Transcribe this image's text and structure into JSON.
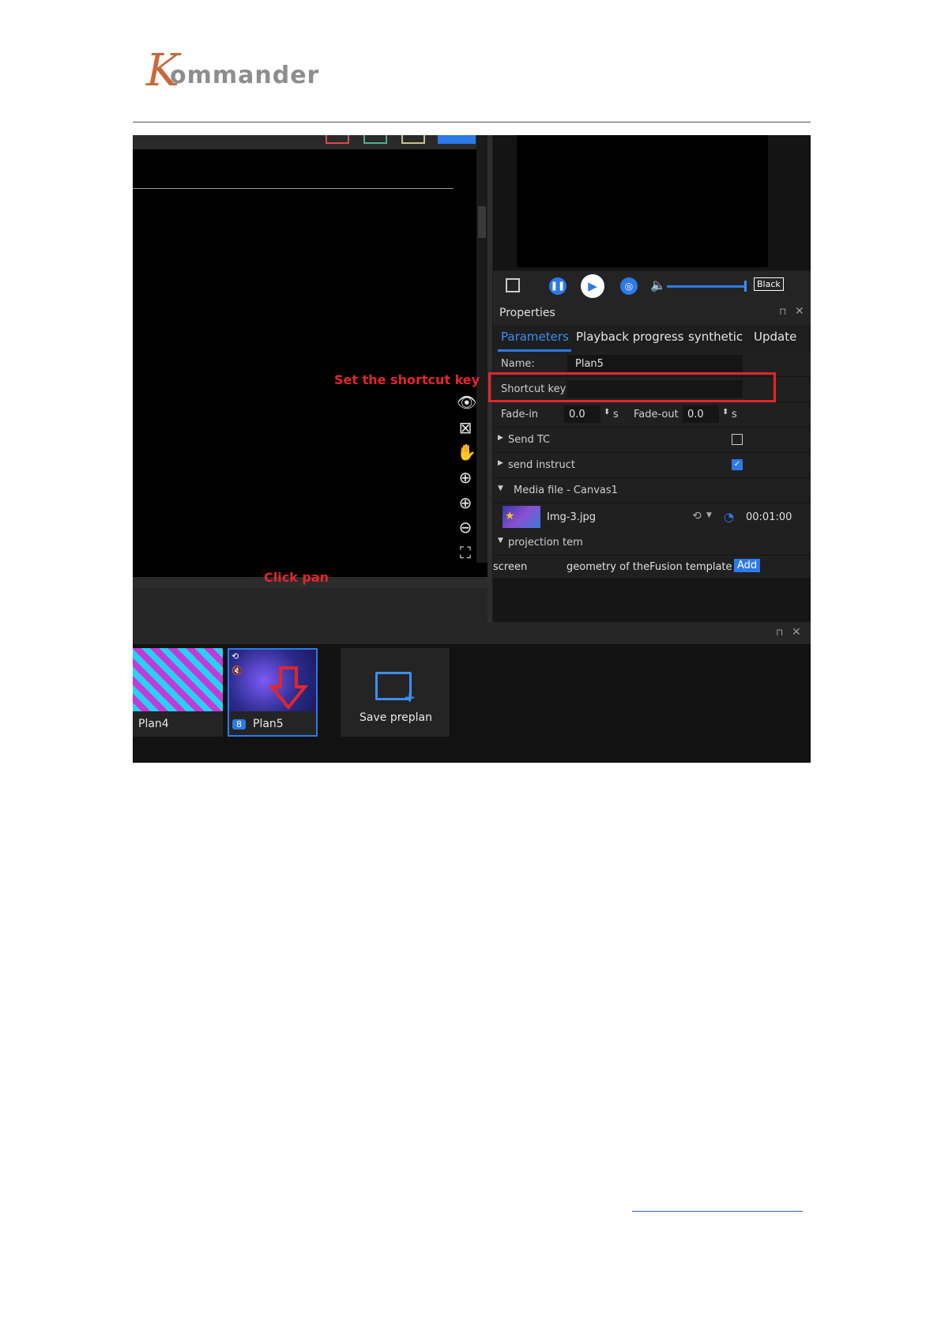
{
  "header": {
    "logo_k": "K",
    "logo_text": "ommander"
  },
  "screenshot": {
    "right_panel": {
      "properties_title": "Properties",
      "tabs": [
        "Parameters",
        "Playback progress",
        "synthetic",
        "Update"
      ],
      "name_label": "Name:",
      "name_value": "Plan5",
      "shortcut_label": "Shortcut key",
      "fade_in_label": "Fade-in",
      "fade_in_value": "0.0",
      "fade_out_label": "Fade-out",
      "fade_out_value": "0.0",
      "unit_s": "s",
      "send_tc_label": "Send TC",
      "send_instruct_label": "send instruct",
      "media_file_label": "Media file - Canvas1",
      "media_name": "Img-3.jpg",
      "media_duration": "00:01:00",
      "projection_label": "projection tem",
      "screen_label": "screen",
      "geometry_label": "geometry of theFusion template",
      "add_button": "Add",
      "black_button": "Black"
    },
    "plans": [
      {
        "name": "Plan4",
        "badge": ""
      },
      {
        "name": "Plan5",
        "badge": "8"
      },
      {
        "name": "Save preplan",
        "badge": ""
      }
    ],
    "annotations": {
      "set_shortcut": "Set the shortcut key",
      "click_pan": "Click pan"
    }
  },
  "colors": {
    "accent": "#2d7ae8",
    "annotation": "#e2262b"
  }
}
